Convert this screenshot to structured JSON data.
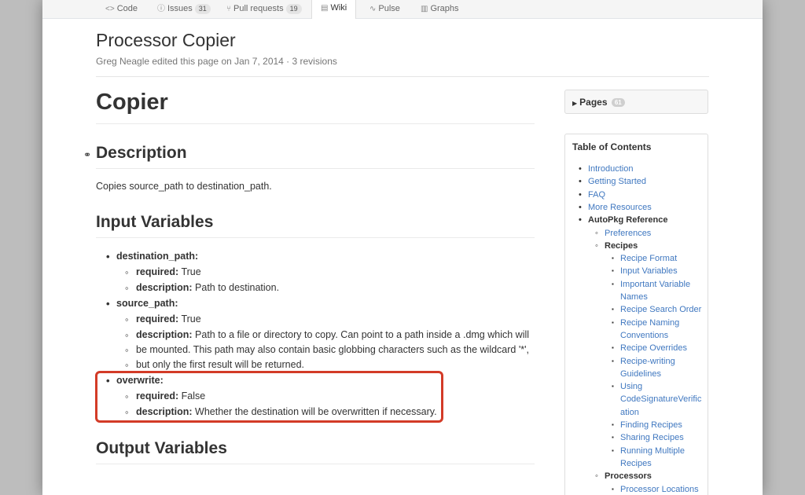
{
  "repo_nav": {
    "tabs": [
      {
        "label": "Code",
        "icon": "code-icon"
      },
      {
        "label": "Issues",
        "count": "31",
        "icon": "issue-icon"
      },
      {
        "label": "Pull requests",
        "count": "19",
        "icon": "pull-request-icon"
      },
      {
        "label": "Wiki",
        "icon": "book-icon",
        "selected": true
      },
      {
        "label": "Pulse",
        "icon": "pulse-icon"
      },
      {
        "label": "Graphs",
        "icon": "graph-icon"
      }
    ]
  },
  "wiki": {
    "title": "Processor Copier",
    "meta": "Greg Neagle edited this page on Jan 7, 2014 · 3 revisions"
  },
  "content": {
    "heading": "Copier",
    "description_heading": "Description",
    "description_text": "Copies source_path to destination_path.",
    "input_heading": "Input Variables",
    "output_heading": "Output Variables",
    "variables": [
      {
        "name": "destination_path:",
        "required_label": "required:",
        "required_value": "True",
        "description_label": "description:",
        "description_lines": [
          "Path to destination."
        ]
      },
      {
        "name": "source_path:",
        "required_label": "required:",
        "required_value": "True",
        "description_label": "description:",
        "description_lines": [
          "Path to a file or directory to copy. Can point to a path inside a .dmg which will",
          "be mounted. This path may also contain basic globbing characters such as the wildcard '*',",
          "but only the first result will be returned."
        ]
      },
      {
        "name": "overwrite:",
        "required_label": "required:",
        "required_value": "False",
        "description_label": "description:",
        "description_lines": [
          "Whether the destination will be overwritten if necessary."
        ]
      }
    ],
    "highlight_color": "#d33b27"
  },
  "sidebar": {
    "pages_label": "Pages",
    "pages_count": "61",
    "toc_title": "Table of Contents",
    "toc": [
      {
        "label": "Introduction",
        "level": 1,
        "link": true
      },
      {
        "label": "Getting Started",
        "level": 1,
        "link": true
      },
      {
        "label": "FAQ",
        "level": 1,
        "link": true
      },
      {
        "label": "More Resources",
        "level": 1,
        "link": true
      },
      {
        "label": "AutoPkg Reference",
        "level": 1,
        "link": false
      },
      {
        "label": "Preferences",
        "level": 2,
        "link": true
      },
      {
        "label": "Recipes",
        "level": 2,
        "link": false
      },
      {
        "label": "Recipe Format",
        "level": 3,
        "link": true
      },
      {
        "label": "Input Variables",
        "level": 3,
        "link": true
      },
      {
        "label": "Important Variable",
        "level": 3,
        "link": true
      },
      {
        "label": "Names",
        "level": 3,
        "link": true,
        "continuation": true
      },
      {
        "label": "Recipe Search Order",
        "level": 3,
        "link": true
      },
      {
        "label": "Recipe Naming",
        "level": 3,
        "link": true
      },
      {
        "label": "Conventions",
        "level": 3,
        "link": true,
        "continuation": true
      },
      {
        "label": "Recipe Overrides",
        "level": 3,
        "link": true
      },
      {
        "label": "Recipe-writing",
        "level": 3,
        "link": true
      },
      {
        "label": "Guidelines",
        "level": 3,
        "link": true,
        "continuation": true
      },
      {
        "label": "Using",
        "level": 3,
        "link": true
      },
      {
        "label": "CodeSignatureVerific",
        "level": 3,
        "link": true,
        "continuation": true
      },
      {
        "label": "ation",
        "level": 3,
        "link": true,
        "continuation": true
      },
      {
        "label": "Finding Recipes",
        "level": 3,
        "link": true
      },
      {
        "label": "Sharing Recipes",
        "level": 3,
        "link": true
      },
      {
        "label": "Running Multiple",
        "level": 3,
        "link": true
      },
      {
        "label": "Recipes",
        "level": 3,
        "link": true,
        "continuation": true
      },
      {
        "label": "Processors",
        "level": 2,
        "link": false
      },
      {
        "label": "Processor Locations",
        "level": 3,
        "link": true
      }
    ]
  }
}
